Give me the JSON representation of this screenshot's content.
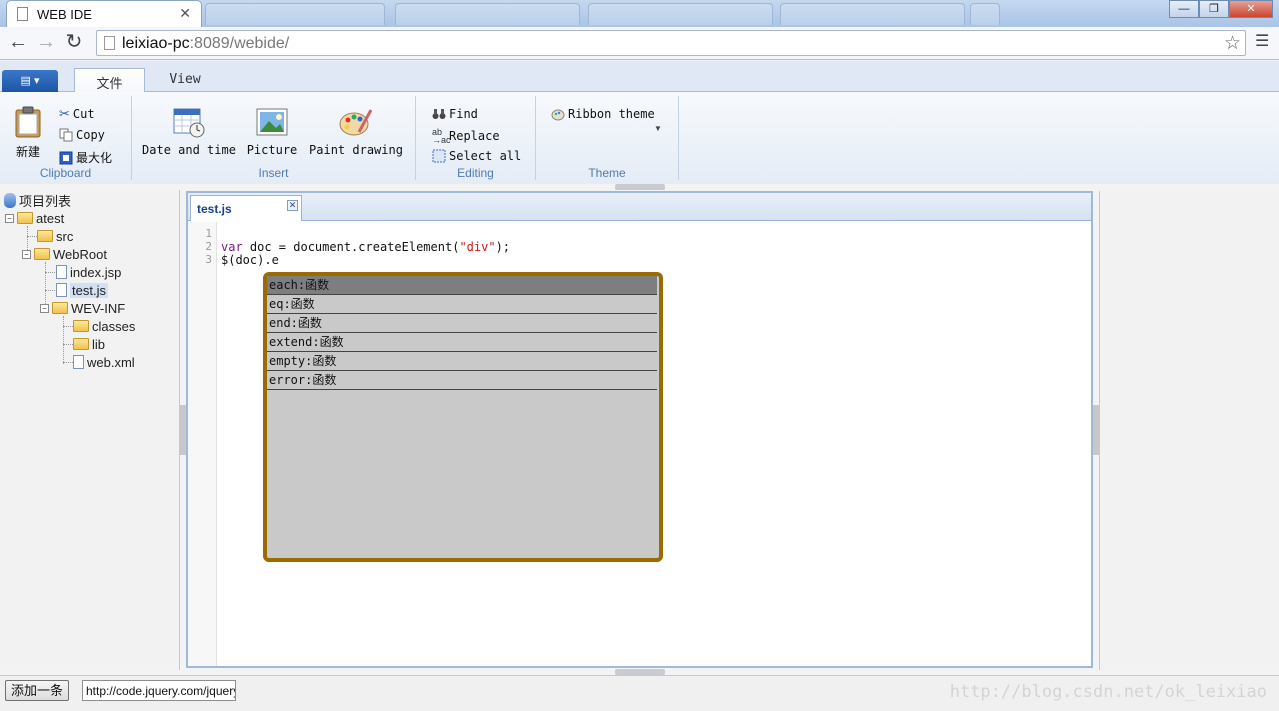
{
  "browser": {
    "tab_title": "WEB IDE",
    "tab_close": "✕",
    "url_host": "leixiao-pc",
    "url_rest": ":8089/webide/",
    "win_minimize": "—",
    "win_restore": "❐",
    "win_close": "✕"
  },
  "ribbon": {
    "app_button": "▤ ▾",
    "tabs": [
      {
        "label": "文件",
        "active": true
      },
      {
        "label": "View",
        "active": false
      }
    ],
    "groups": {
      "clipboard": {
        "label": "Clipboard",
        "new_label": "新建",
        "cut_label": "Cut",
        "copy_label": "Copy",
        "maximize_label": "最大化"
      },
      "insert": {
        "label": "Insert",
        "datetime_label": "Date and time",
        "picture_label": "Picture",
        "paint_label": "Paint drawing"
      },
      "editing": {
        "label": "Editing",
        "find_label": "Find",
        "replace_label": "Replace",
        "select_all_label": "Select all"
      },
      "theme": {
        "label": "Theme",
        "ribbon_theme_label": "Ribbon theme"
      }
    }
  },
  "tree": {
    "root_label": "项目列表",
    "items": [
      {
        "label": "atest",
        "type": "folder"
      },
      {
        "label": "src",
        "type": "folder"
      },
      {
        "label": "WebRoot",
        "type": "folder"
      },
      {
        "label": "index.jsp",
        "type": "file"
      },
      {
        "label": "test.js",
        "type": "file",
        "selected": true
      },
      {
        "label": "WEV-INF",
        "type": "folder"
      },
      {
        "label": "classes",
        "type": "folder"
      },
      {
        "label": "lib",
        "type": "folder"
      },
      {
        "label": "web.xml",
        "type": "file"
      }
    ]
  },
  "editor": {
    "tab_label": "test.js",
    "tab_close": "✕",
    "line_numbers": [
      "1",
      "2",
      "3"
    ],
    "code": {
      "line2_kw": "var",
      "line2_mid": " doc = document.createElement(",
      "line2_str": "\"div\"",
      "line2_end": ");",
      "line3": "$(doc).e"
    }
  },
  "autocomplete": {
    "items": [
      {
        "label": "each:函数",
        "selected": true
      },
      {
        "label": "eq:函数",
        "selected": false
      },
      {
        "label": "end:函数",
        "selected": false
      },
      {
        "label": "extend:函数",
        "selected": false
      },
      {
        "label": "empty:函数",
        "selected": false
      },
      {
        "label": "error:函数",
        "selected": false
      }
    ]
  },
  "bottom": {
    "add_button": "添加一条",
    "url_input_value": "http://code.jquery.com/jquery"
  },
  "watermark": "http://blog.csdn.net/ok_leixiao",
  "colors": {
    "popup_border": "#9b6a00",
    "popup_bg": "#c9c9c9",
    "popup_selected": "#7e7e7e",
    "ribbon_accent": "#4f7bb5",
    "keyword": "#7a1a8c",
    "string": "#c41a16"
  }
}
